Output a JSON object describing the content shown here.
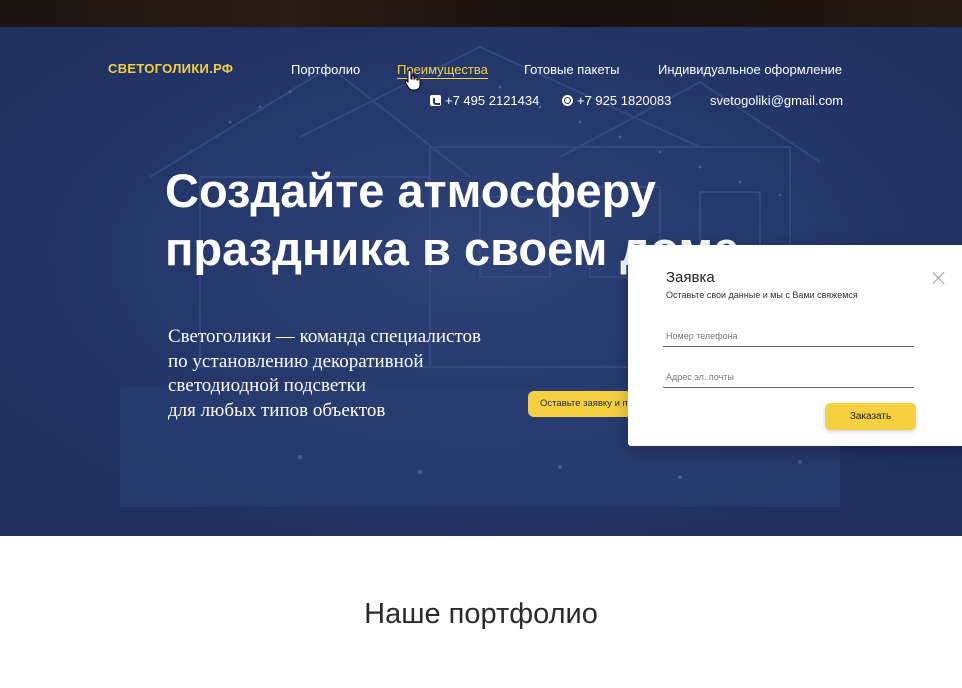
{
  "header": {
    "logo": "СВЕТОГОЛИКИ.РФ",
    "nav": [
      {
        "label": "Портфолио",
        "active": false
      },
      {
        "label": "Преимущества",
        "active": true
      },
      {
        "label": "Готовые пакеты",
        "active": false
      },
      {
        "label": "Индивидуальное оформление",
        "active": false
      }
    ],
    "phone": "+7 495 2121434",
    "whatsapp": "+7 925 1820083",
    "email": "svetogoliki@gmail.com"
  },
  "hero": {
    "headline_line1": "Создайте атмосферу",
    "headline_line2": "праздника в своем доме",
    "sub_lines": [
      "Светоголики — команда специалистов",
      "по установлению декоративной",
      "светодиодной подсветки",
      "для любых типов объектов"
    ],
    "cta_label": "Оставьте заявку и получите",
    "bg_color": "#243766",
    "accent": "#f5d142"
  },
  "modal": {
    "title": "Заявка",
    "subtitle": "Оставьте свои данные и мы с Вами свяжемся",
    "phone_placeholder": "Номер телефона",
    "email_placeholder": "Адрес эл. почты",
    "submit_label": "Заказать"
  },
  "portfolio": {
    "title": "Наше портфолио"
  }
}
